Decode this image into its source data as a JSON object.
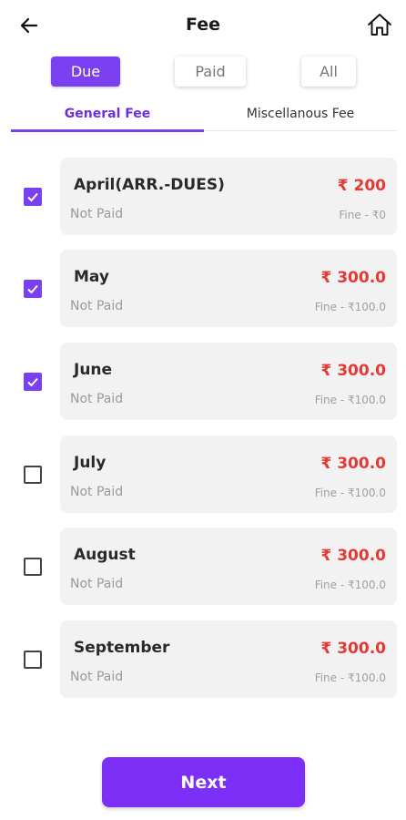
{
  "header": {
    "title": "Fee",
    "back_icon": "arrow-left-icon",
    "home_icon": "home-icon"
  },
  "filters": [
    {
      "label": "Due",
      "active": true
    },
    {
      "label": "Paid",
      "active": false
    },
    {
      "label": "All",
      "active": false
    }
  ],
  "tabs": [
    {
      "label": "General Fee",
      "active": true
    },
    {
      "label": "Miscellanous Fee",
      "active": false
    }
  ],
  "fees": [
    {
      "month": "April(ARR.-DUES)",
      "status": "Not Paid",
      "amount": "₹ 200",
      "fine": "Fine - ₹0",
      "checked": true
    },
    {
      "month": "May",
      "status": "Not Paid",
      "amount": "₹ 300.0",
      "fine": "Fine - ₹100.0",
      "checked": true
    },
    {
      "month": "June",
      "status": "Not Paid",
      "amount": "₹ 300.0",
      "fine": "Fine - ₹100.0",
      "checked": true
    },
    {
      "month": "July",
      "status": "Not Paid",
      "amount": "₹ 300.0",
      "fine": "Fine - ₹100.0",
      "checked": false
    },
    {
      "month": "August",
      "status": "Not Paid",
      "amount": "₹ 300.0",
      "fine": "Fine - ₹100.0",
      "checked": false
    },
    {
      "month": "September",
      "status": "Not Paid",
      "amount": "₹ 300.0",
      "fine": "Fine - ₹100.0",
      "checked": false
    }
  ],
  "next_label": "Next",
  "colors": {
    "accent": "#7a3ff0",
    "amount": "#e53935",
    "card": "#f2f2f2"
  }
}
